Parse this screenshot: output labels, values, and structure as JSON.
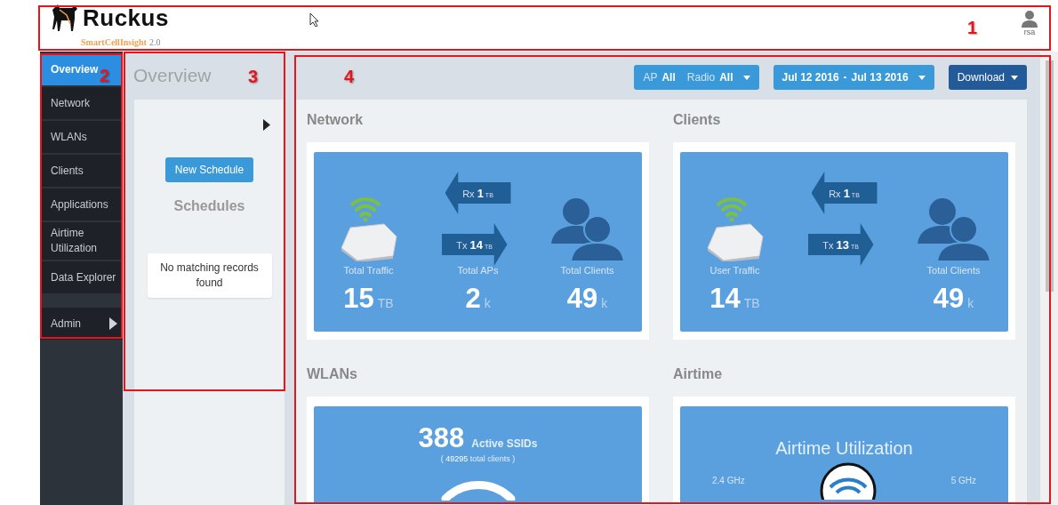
{
  "header": {
    "logo": "Ruckus",
    "product": "SmartCellInsight",
    "version": "2.0",
    "user": "rsa"
  },
  "sidebar": {
    "items": [
      {
        "label": "Overview",
        "selected": true,
        "kind": "link"
      },
      {
        "label": "Network",
        "selected": false,
        "kind": "link"
      },
      {
        "label": "WLANs",
        "selected": false,
        "kind": "link"
      },
      {
        "label": "Clients",
        "selected": false,
        "kind": "link"
      },
      {
        "label": "Applications",
        "selected": false,
        "kind": "link"
      },
      {
        "label": "Airtime Utilization",
        "selected": false,
        "kind": "link"
      },
      {
        "label": "Data Explorer",
        "selected": false,
        "kind": "link"
      },
      {
        "label": "Admin",
        "selected": false,
        "kind": "submenu"
      }
    ]
  },
  "schedule_panel": {
    "title": "Overview",
    "button": "New Schedule",
    "heading": "Schedules",
    "empty_message": "No matching records found"
  },
  "filters": {
    "ap_label": "AP",
    "ap_value": "All",
    "radio_label": "Radio",
    "radio_value": "All",
    "date_from": "Jul 12 2016",
    "date_separator": "-",
    "date_to": "Jul 13 2016",
    "download": "Download"
  },
  "cards": [
    {
      "title": "Network",
      "kind": "traffic",
      "rx": {
        "label": "Rx",
        "value": "1",
        "unit": "TB"
      },
      "tx": {
        "label": "Tx",
        "value": "14",
        "unit": "TB"
      },
      "stats": [
        {
          "label": "Total Traffic",
          "value": "15",
          "unit": "TB"
        },
        {
          "label": "Total APs",
          "value": "2",
          "unit": "k"
        },
        {
          "label": "Total Clients",
          "value": "49",
          "unit": "k"
        }
      ]
    },
    {
      "title": "Clients",
      "kind": "traffic",
      "rx": {
        "label": "Rx",
        "value": "1",
        "unit": "TB"
      },
      "tx": {
        "label": "Tx",
        "value": "13",
        "unit": "TB"
      },
      "stats": [
        {
          "label": "User Traffic",
          "value": "14",
          "unit": "TB"
        },
        {
          "label": "Total Clients",
          "value": "49",
          "unit": "k"
        }
      ]
    },
    {
      "title": "WLANs",
      "kind": "ssids",
      "count": "388",
      "count_label": "Active SSIDs",
      "subtitle": "( **49295** total clients )"
    },
    {
      "title": "Airtime",
      "kind": "airtime",
      "heading": "Airtime Utilization",
      "bands": [
        "2.4 GHz",
        "5 GHz"
      ]
    }
  ],
  "annotations": [
    {
      "label": "1"
    },
    {
      "label": "2"
    },
    {
      "label": "3"
    },
    {
      "label": "4"
    }
  ]
}
